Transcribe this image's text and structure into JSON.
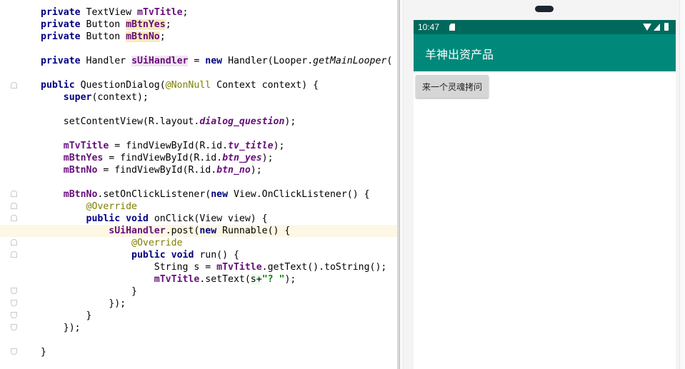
{
  "editor": {
    "lines": [
      {
        "parts": [
          {
            "t": "private ",
            "c": "k"
          },
          {
            "t": "TextView "
          },
          {
            "t": "mTvTitle",
            "c": "f"
          },
          {
            "t": ";"
          }
        ]
      },
      {
        "parts": [
          {
            "t": "private ",
            "c": "k"
          },
          {
            "t": "Button "
          },
          {
            "t": "mBtnYes",
            "c": "fh"
          },
          {
            "t": ";"
          }
        ]
      },
      {
        "parts": [
          {
            "t": "private ",
            "c": "k"
          },
          {
            "t": "Button "
          },
          {
            "t": "mBtnNo",
            "c": "fh"
          },
          {
            "t": ";"
          }
        ]
      },
      {
        "parts": []
      },
      {
        "parts": [
          {
            "t": "private ",
            "c": "k"
          },
          {
            "t": "Handler "
          },
          {
            "t": "sUiHandler",
            "c": "fp"
          },
          {
            "t": " = "
          },
          {
            "t": "new ",
            "c": "k"
          },
          {
            "t": "Handler(Looper."
          },
          {
            "t": "getMainLooper",
            "c": "m"
          },
          {
            "t": "("
          }
        ]
      },
      {
        "parts": []
      },
      {
        "parts": [
          {
            "t": "public ",
            "c": "k"
          },
          {
            "t": "QuestionDialog("
          },
          {
            "t": "@NonNull",
            "c": "an"
          },
          {
            "t": " Context context) {"
          }
        ]
      },
      {
        "parts": [
          {
            "t": "    "
          },
          {
            "t": "super",
            "c": "k"
          },
          {
            "t": "(context);"
          }
        ]
      },
      {
        "parts": []
      },
      {
        "parts": [
          {
            "t": "    setContentView(R.layout."
          },
          {
            "t": "dialog_question",
            "c": "fi"
          },
          {
            "t": ");"
          }
        ]
      },
      {
        "parts": []
      },
      {
        "parts": [
          {
            "t": "    "
          },
          {
            "t": "mTvTitle",
            "c": "f"
          },
          {
            "t": " = findViewById(R.id."
          },
          {
            "t": "tv_title",
            "c": "fi"
          },
          {
            "t": ");"
          }
        ]
      },
      {
        "parts": [
          {
            "t": "    "
          },
          {
            "t": "mBtnYes",
            "c": "f"
          },
          {
            "t": " = findViewById(R.id."
          },
          {
            "t": "btn_yes",
            "c": "fi"
          },
          {
            "t": ");"
          }
        ]
      },
      {
        "parts": [
          {
            "t": "    "
          },
          {
            "t": "mBtnNo",
            "c": "f"
          },
          {
            "t": " = findViewById(R.id."
          },
          {
            "t": "btn_no",
            "c": "fi"
          },
          {
            "t": ");"
          }
        ]
      },
      {
        "parts": []
      },
      {
        "parts": [
          {
            "t": "    "
          },
          {
            "t": "mBtnNo",
            "c": "f"
          },
          {
            "t": ".setOnClickListener("
          },
          {
            "t": "new ",
            "c": "k"
          },
          {
            "t": "View.OnClickListener() {"
          }
        ]
      },
      {
        "parts": [
          {
            "t": "        "
          },
          {
            "t": "@Override",
            "c": "an"
          }
        ]
      },
      {
        "parts": [
          {
            "t": "        "
          },
          {
            "t": "public void ",
            "c": "k"
          },
          {
            "t": "onClick(View view) {"
          }
        ]
      },
      {
        "parts": [
          {
            "t": "            "
          },
          {
            "t": "sUiHandler",
            "c": "f"
          },
          {
            "t": ".post("
          },
          {
            "t": "new ",
            "c": "k"
          },
          {
            "t": "Runnable() {"
          }
        ],
        "highlight": true
      },
      {
        "parts": [
          {
            "t": "                "
          },
          {
            "t": "@Override",
            "c": "an"
          }
        ]
      },
      {
        "parts": [
          {
            "t": "                "
          },
          {
            "t": "public void ",
            "c": "k"
          },
          {
            "t": "run() {"
          }
        ]
      },
      {
        "parts": [
          {
            "t": "                    String s = "
          },
          {
            "t": "mTvTitle",
            "c": "f"
          },
          {
            "t": ".getText().toString();"
          }
        ]
      },
      {
        "parts": [
          {
            "t": "                    "
          },
          {
            "t": "mTvTitle",
            "c": "f"
          },
          {
            "t": ".setText("
          },
          {
            "t": "s+",
            "c": "hlv"
          },
          {
            "t": "\"? \"",
            "c": "s"
          },
          {
            "t": ");"
          }
        ]
      },
      {
        "parts": [
          {
            "t": "                }"
          }
        ]
      },
      {
        "parts": [
          {
            "t": "            });"
          }
        ]
      },
      {
        "parts": [
          {
            "t": "        }"
          }
        ]
      },
      {
        "parts": [
          {
            "t": "    });"
          }
        ]
      },
      {
        "parts": []
      },
      {
        "parts": [
          {
            "t": "}"
          }
        ]
      }
    ]
  },
  "phone": {
    "status_time": "10:47",
    "app_title": "羊神出资产品",
    "button_label": "来一个灵魂拷问"
  },
  "colors": {
    "status_bar": "#00695c",
    "app_bar": "#00897b",
    "button": "#d6d6d6"
  },
  "icons": [
    "sd-card-icon",
    "wifi-icon",
    "signal-icon",
    "battery-icon",
    "fold-marker-icon",
    "mouse-cursor-icon",
    "camera-icon"
  ]
}
